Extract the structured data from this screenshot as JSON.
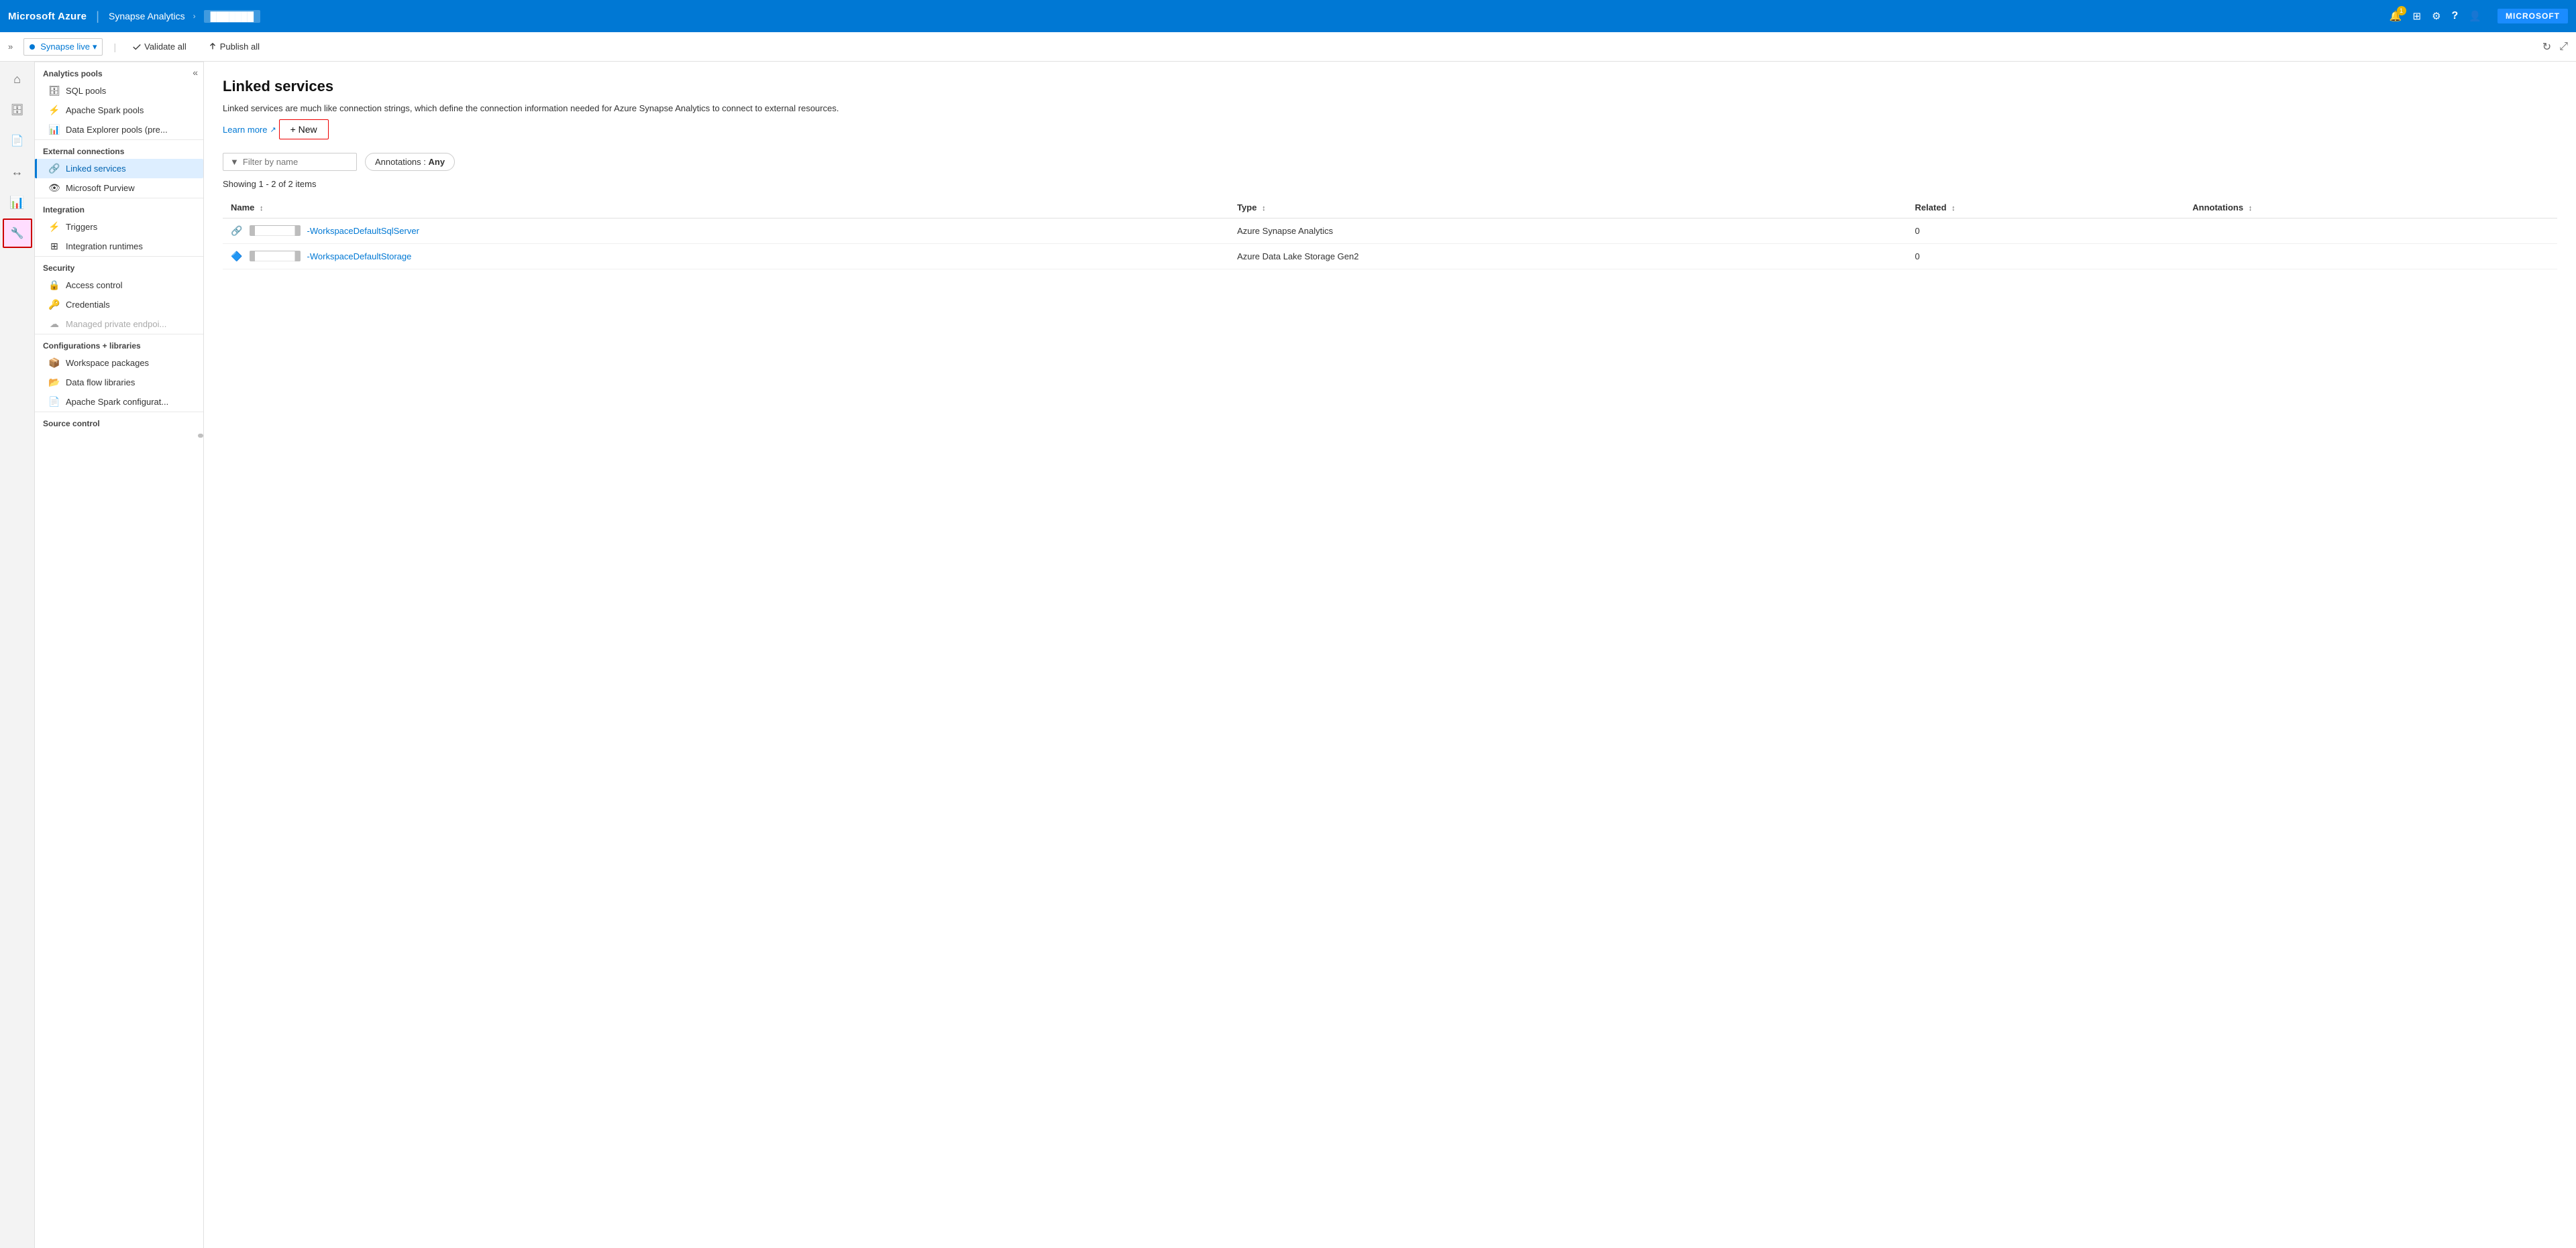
{
  "topNav": {
    "brand": "Microsoft Azure",
    "separator": "|",
    "service": "Synapse Analytics",
    "arrow": "›",
    "workspaceBadge": "",
    "icons": [
      {
        "name": "notification-icon",
        "glyph": "🔔",
        "badge": true
      },
      {
        "name": "remote-icon",
        "glyph": "⊞"
      },
      {
        "name": "bell-icon",
        "glyph": "🔔"
      },
      {
        "name": "settings-icon",
        "glyph": "⚙"
      },
      {
        "name": "help-icon",
        "glyph": "?"
      },
      {
        "name": "user-icon",
        "glyph": "👤"
      }
    ],
    "account": "MICROSOFT"
  },
  "toolbar": {
    "collapse": "«",
    "synapseLive": "Synapse live",
    "validateAll": "Validate all",
    "publishAll": "Publish all",
    "refreshIcon": "↻",
    "publishIcon": "📋"
  },
  "iconSidebar": {
    "items": [
      {
        "name": "home-icon",
        "glyph": "⌂",
        "active": false
      },
      {
        "name": "data-icon",
        "glyph": "🗄",
        "active": false
      },
      {
        "name": "develop-icon",
        "glyph": "📄",
        "active": false
      },
      {
        "name": "integrate-icon",
        "glyph": "↔",
        "active": false
      },
      {
        "name": "monitor-icon",
        "glyph": "📊",
        "active": false
      },
      {
        "name": "manage-icon",
        "glyph": "🔧",
        "active": true,
        "activeRed": true
      }
    ]
  },
  "sidebar": {
    "collapseBtn": "«",
    "sections": [
      {
        "header": "Analytics pools",
        "items": [
          {
            "label": "SQL pools",
            "icon": "🗄",
            "active": false
          },
          {
            "label": "Apache Spark pools",
            "icon": "⚡",
            "active": false
          },
          {
            "label": "Data Explorer pools (pre...",
            "icon": "📊",
            "active": false
          }
        ]
      },
      {
        "header": "External connections",
        "items": [
          {
            "label": "Linked services",
            "icon": "🔗",
            "active": true
          },
          {
            "label": "Microsoft Purview",
            "icon": "👁",
            "active": false
          }
        ]
      },
      {
        "header": "Integration",
        "items": [
          {
            "label": "Triggers",
            "icon": "⚡",
            "active": false
          },
          {
            "label": "Integration runtimes",
            "icon": "⊞",
            "active": false
          }
        ]
      },
      {
        "header": "Security",
        "items": [
          {
            "label": "Access control",
            "icon": "🔒",
            "active": false
          },
          {
            "label": "Credentials",
            "icon": "🔑",
            "active": false
          },
          {
            "label": "Managed private endpoi...",
            "icon": "☁",
            "active": false,
            "disabled": true
          }
        ]
      },
      {
        "header": "Configurations + libraries",
        "items": [
          {
            "label": "Workspace packages",
            "icon": "📦",
            "active": false
          },
          {
            "label": "Data flow libraries",
            "icon": "📂",
            "active": false
          },
          {
            "label": "Apache Spark configurat...",
            "icon": "📄",
            "active": false
          }
        ]
      },
      {
        "header": "Source control",
        "items": []
      }
    ]
  },
  "content": {
    "title": "Linked services",
    "description": "Linked services are much like connection strings, which define the connection information needed for Azure Synapse Analytics to connect to external resources.",
    "learnMore": "Learn more",
    "newButton": "+ New",
    "filterPlaceholder": "Filter by name",
    "filterIcon": "▼",
    "annotationsLabel": "Annotations : ",
    "annotationsValue": "Any",
    "showingCount": "Showing 1 - 2 of 2 items",
    "tableHeaders": [
      {
        "label": "Name",
        "sort": "↕"
      },
      {
        "label": "Type",
        "sort": "↕"
      },
      {
        "label": "Related",
        "sort": "↕"
      },
      {
        "label": "Annotations",
        "sort": "↕"
      }
    ],
    "tableRows": [
      {
        "namePrefix": "",
        "nameSuffix": "-WorkspaceDefaultSqlServer",
        "type": "Azure Synapse Analytics",
        "related": "0",
        "annotations": ""
      },
      {
        "namePrefix": "",
        "nameSuffix": "-WorkspaceDefaultStorage",
        "type": "Azure Data Lake Storage Gen2",
        "related": "0",
        "annotations": ""
      }
    ]
  }
}
